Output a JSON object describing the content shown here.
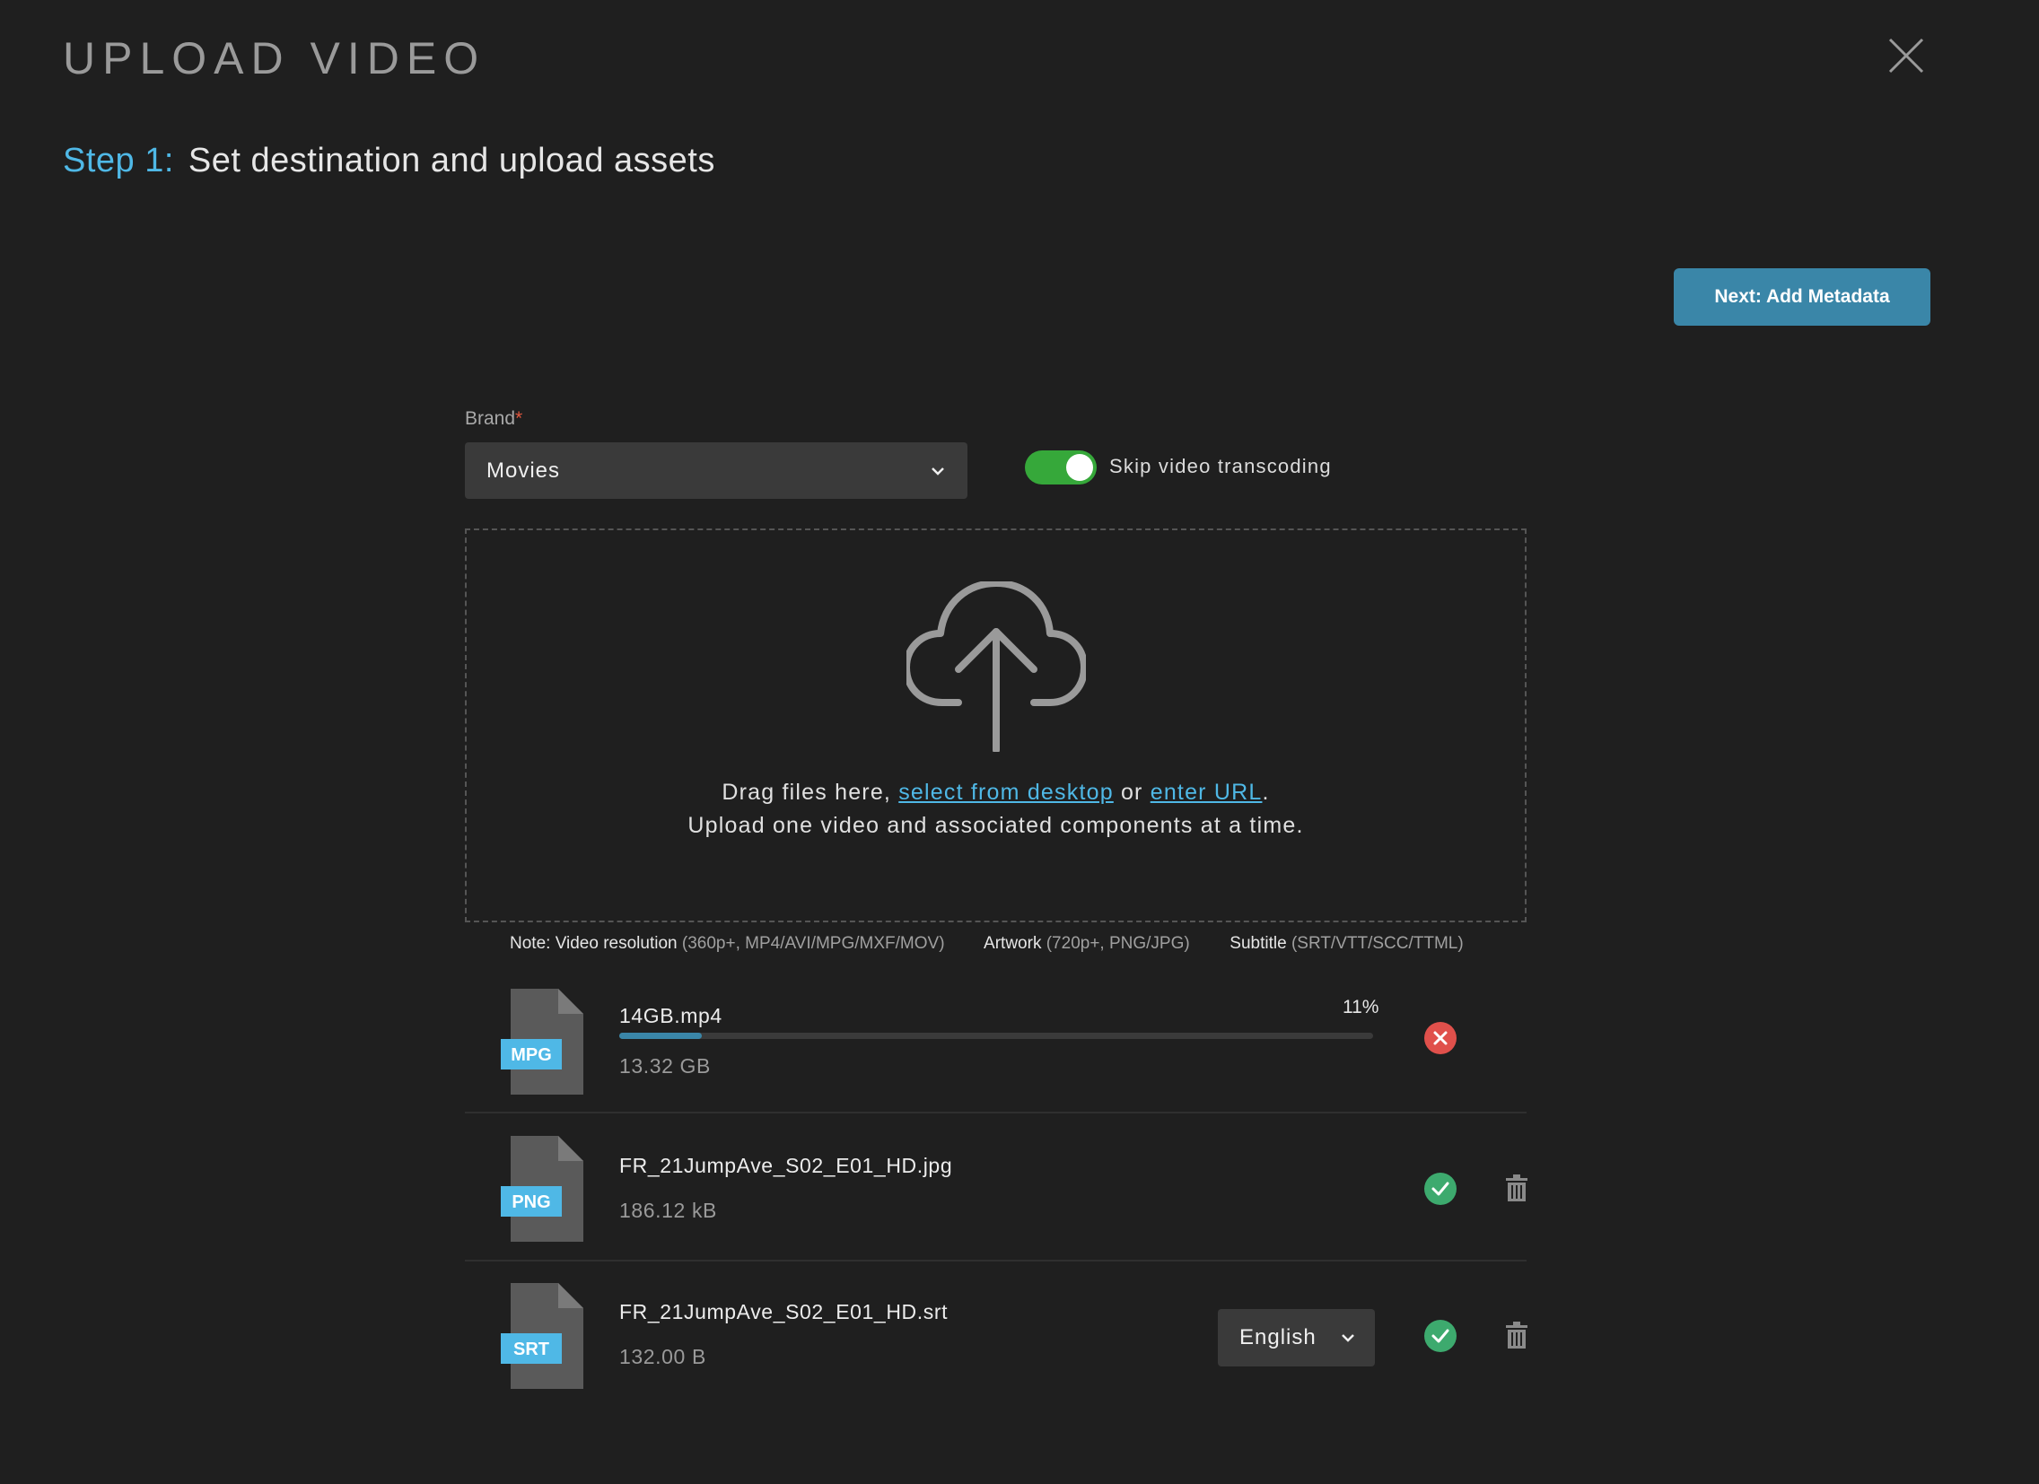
{
  "header": {
    "title": "UPLOAD VIDEO",
    "step_label": "Step 1:",
    "step_text": "Set destination and upload assets"
  },
  "actions": {
    "next_label": "Next: Add Metadata"
  },
  "brand": {
    "label": "Brand",
    "required_marker": "*",
    "selected": "Movies"
  },
  "transcoding_toggle": {
    "label": "Skip video transcoding",
    "on": true
  },
  "dropzone": {
    "line1_prefix": "Drag files here, ",
    "link_desktop": "select from desktop",
    "line1_mid": " or ",
    "link_url": "enter URL",
    "line1_suffix": ".",
    "line2": "Upload one video and associated components at a time."
  },
  "note": {
    "video_label": "Note: Video resolution",
    "video_detail": "(360p+, MP4/AVI/MPG/MXF/MOV)",
    "artwork_label": "Artwork",
    "artwork_detail": "(720p+, PNG/JPG)",
    "subtitle_label": "Subtitle",
    "subtitle_detail": "(SRT/VTT/SCC/TTML)"
  },
  "files": [
    {
      "type_badge": "MPG",
      "name": "14GB.mp4",
      "size": "13.32 GB",
      "progress_text": "11%",
      "progress": 0.11,
      "status": "error"
    },
    {
      "type_badge": "PNG",
      "name": "FR_21JumpAve_S02_E01_HD.jpg",
      "size": "186.12 kB",
      "status": "success"
    },
    {
      "type_badge": "SRT",
      "name": "FR_21JumpAve_S02_E01_HD.srt",
      "size": "132.00 B",
      "language": "English",
      "status": "success"
    }
  ],
  "colors": {
    "background": "#1f1f1f",
    "accent": "#4fb8e6",
    "button": "#3a86a8",
    "toggle_on": "#36a83a",
    "success": "#3daa6e",
    "error": "#e0504b"
  }
}
